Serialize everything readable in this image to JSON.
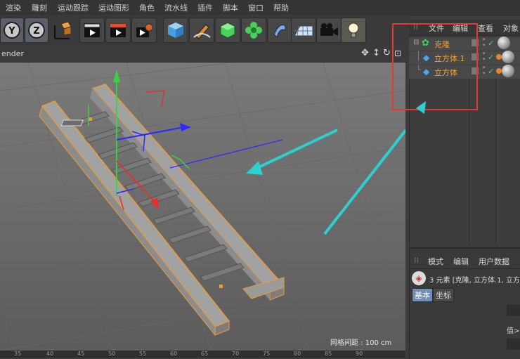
{
  "menu": [
    "渲染",
    "雕刻",
    "运动跟踪",
    "运动图形",
    "角色",
    "流水线",
    "插件",
    "脚本",
    "窗口",
    "帮助"
  ],
  "toolbar": {
    "axis_y": "Y",
    "axis_z": "Z"
  },
  "viewport": {
    "header_label": "ender",
    "grid_spacing": "网格间距 : 100 cm"
  },
  "objects_panel": {
    "tabs": [
      "文件",
      "编辑",
      "查看",
      "对象"
    ],
    "items": [
      {
        "label": "克隆",
        "icon": "cloner-icon"
      },
      {
        "label": "立方体.1",
        "icon": "cube-icon"
      },
      {
        "label": "立方体",
        "icon": "cube-icon"
      }
    ]
  },
  "attributes_panel": {
    "tabs": [
      "模式",
      "编辑",
      "用户数据"
    ],
    "summary": "3 元素 [克隆, 立方体.1, 立方",
    "sub_tabs": [
      "基本",
      "坐标"
    ],
    "value_label": "值>"
  },
  "ruler": {
    "ticks": [
      "35",
      "40",
      "45",
      "50",
      "55",
      "60",
      "65",
      "70",
      "75",
      "80",
      "85",
      "90"
    ]
  },
  "colors": {
    "selection_highlight": "#e23a3a",
    "annotation_arrow": "#2ecfd0",
    "object_outline": "#f09a34"
  }
}
